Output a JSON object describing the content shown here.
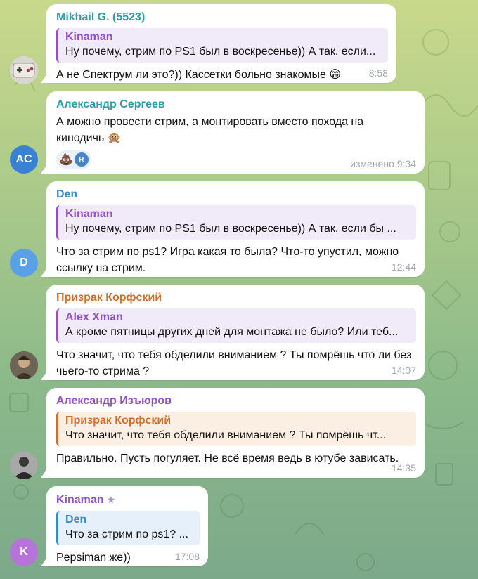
{
  "colors": {
    "purple": "#8e4fd0",
    "orange": "#d26d2a",
    "blue": "#3c8ac7",
    "cyan": "#2e9ea8",
    "avatar_ac": "#3a82d1",
    "avatar_d": "#5aa0e6",
    "avatar_k": "#b673d8"
  },
  "messages": [
    {
      "author": "Mikhail G. (5523)",
      "reply_name": "Kinaman",
      "reply_text": "Ну почему, стрим по PS1 был в воскресенье)) А так, если...",
      "text": "А не Спектрум ли это?)) Кассетки больно знакомые 😁",
      "time": "8:58"
    },
    {
      "author": "Александр Сергеев",
      "avatar_initials": "AC",
      "text": "А можно провести стрим, а монтировать вместо похода на кинодичь 🙊",
      "reaction_emoji": "💩",
      "reaction_avatar": "R",
      "time": "изменено 9:34"
    },
    {
      "author": "Den",
      "avatar_initials": "D",
      "reply_name": "Kinaman",
      "reply_text": "Ну почему, стрим по PS1 был в воскресенье)) А так, если бы ...",
      "text": "Что за стрим по ps1? Игра какая то была? Что-то упустил, можно ссылку на стрим.",
      "time": "12:44"
    },
    {
      "author": "Призрак Корфский",
      "reply_name": "Alex Xman",
      "reply_text": "А кроме пятницы других дней для монтажа не было? Или теб...",
      "text": "Что значит, что тебя обделили вниманием ? Ты помрёшь что ли без чьего-то стрима ?",
      "time": "14:07"
    },
    {
      "author": "Александр Изъюров",
      "reply_name": "Призрак Корфский",
      "reply_text": "Что значит, что тебя обделили вниманием ? Ты помрёшь чт...",
      "text": "Правильно. Пусть погуляет. Не всё время ведь в ютубе зависать.",
      "time": "14:35"
    },
    {
      "author": "Kinaman",
      "avatar_initials": "K",
      "reply_name": "Den",
      "reply_text": "Что за стрим по ps1? ...",
      "text": "Pepsiman же))",
      "time": "17:08"
    }
  ]
}
